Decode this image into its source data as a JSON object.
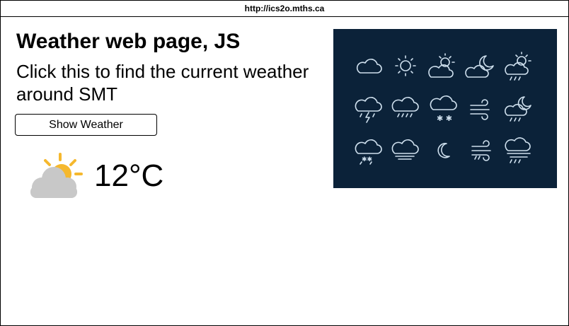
{
  "address_bar": {
    "url": "http://ics2o.mths.ca"
  },
  "page": {
    "title": "Weather web page, JS",
    "instructions": "Click this to find the current weather around SMT",
    "button_label": "Show Weather"
  },
  "weather": {
    "temperature": "12°C",
    "icon": "partly-cloudy-icon"
  },
  "icon_sheet": {
    "background_color": "#0b2239",
    "icons": [
      "cloud-icon",
      "sun-icon",
      "partly-cloudy-icon",
      "cloudy-night-icon",
      "sun-rain-icon",
      "thunderstorm-icon",
      "rain-icon",
      "snow-icon",
      "wind-icon",
      "night-rain-icon",
      "sleet-icon",
      "fog-icon",
      "moon-icon",
      "windy-rain-icon",
      "storm-wind-icon"
    ]
  },
  "colors": {
    "sun": "#f5b82e",
    "cloud": "#c8c8c8",
    "icon_line": "#cfe0ee"
  }
}
